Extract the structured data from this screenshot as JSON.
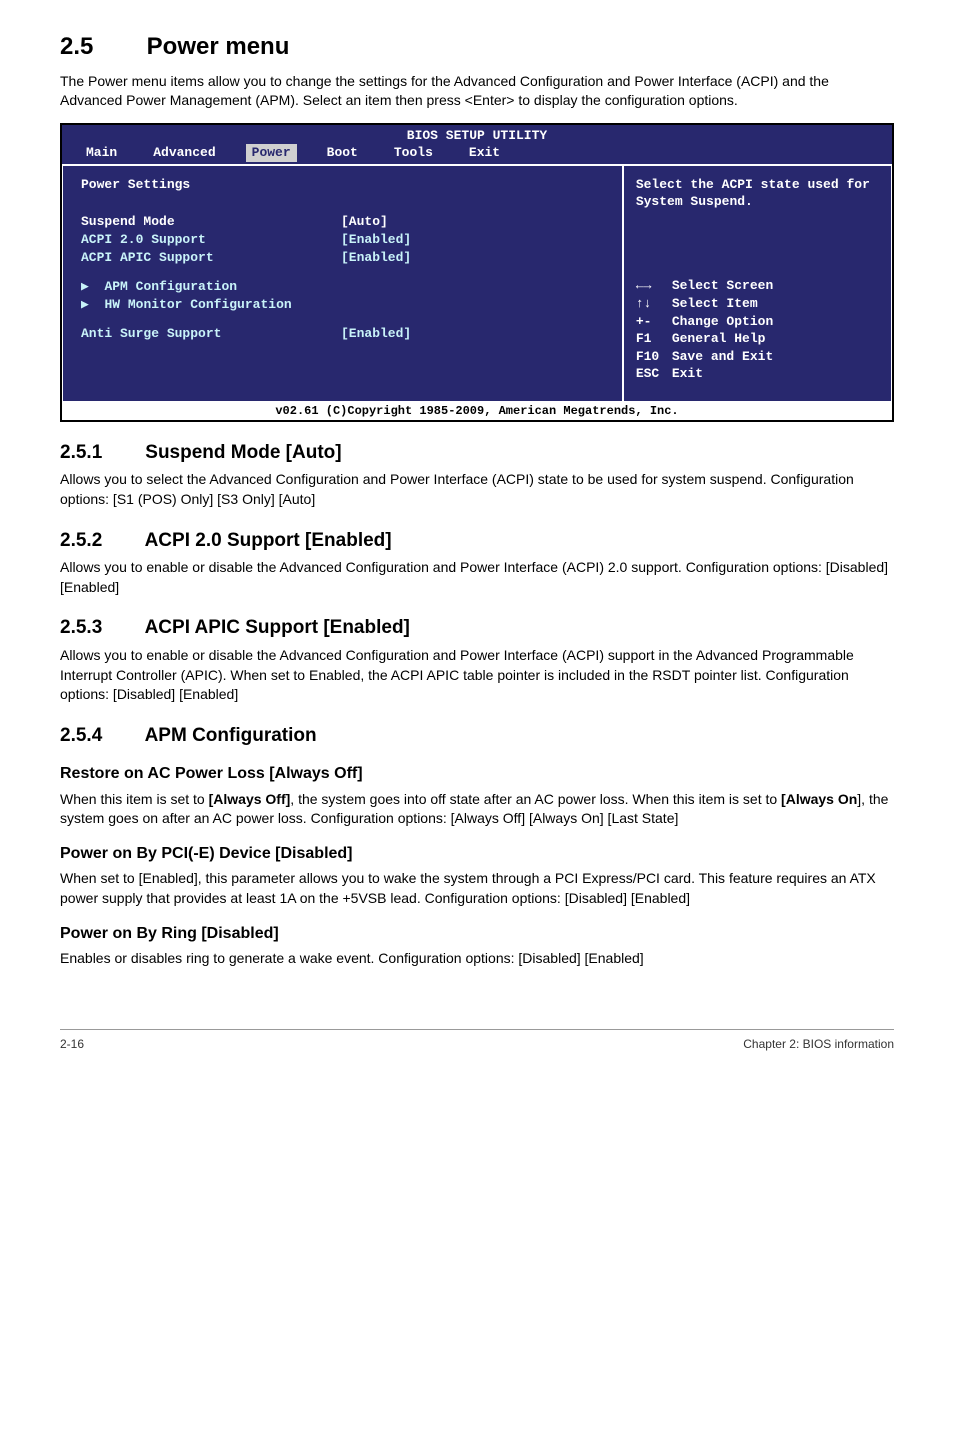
{
  "h1_num": "2.5",
  "h1_title": "Power menu",
  "intro": "The Power menu items allow you to change the settings for the Advanced Configuration and Power Interface (ACPI) and the Advanced Power Management (APM). Select an item then press <Enter> to display the configuration options.",
  "bios": {
    "title": "BIOS SETUP UTILITY",
    "menu": {
      "main": "Main",
      "advanced": "Advanced",
      "power": "Power",
      "boot": "Boot",
      "tools": "Tools",
      "exit": "Exit"
    },
    "heading": "Power Settings",
    "rows": [
      {
        "label": "Suspend Mode",
        "value": "[Auto]",
        "sel": true
      },
      {
        "label": "ACPI 2.0 Support",
        "value": "[Enabled]"
      },
      {
        "label": "ACPI APIC Support",
        "value": "[Enabled]"
      }
    ],
    "subs": [
      "APM Configuration",
      "HW Monitor Configuration"
    ],
    "anti": {
      "label": "Anti Surge Support",
      "value": "[Enabled]"
    },
    "help_top": "Select the ACPI state used for System Suspend.",
    "keys": [
      {
        "k": "←→",
        "d": "Select Screen"
      },
      {
        "k": "↑↓",
        "d": "Select Item"
      },
      {
        "k": "+-",
        "d": "Change Option"
      },
      {
        "k": "F1",
        "d": "General Help"
      },
      {
        "k": "F10",
        "d": "Save and Exit"
      },
      {
        "k": "ESC",
        "d": "Exit"
      }
    ],
    "footer": "v02.61 (C)Copyright 1985-2009, American Megatrends, Inc."
  },
  "s251_num": "2.5.1",
  "s251_title": "Suspend Mode [Auto]",
  "s251_body": "Allows you to select the Advanced Configuration and Power Interface (ACPI) state to be used for system suspend. Configuration options: [S1 (POS) Only] [S3 Only] [Auto]",
  "s252_num": "2.5.2",
  "s252_title": "ACPI 2.0 Support [Enabled]",
  "s252_body": "Allows you to enable or disable the Advanced Configuration and Power Interface (ACPI) 2.0 support. Configuration options: [Disabled] [Enabled]",
  "s253_num": "2.5.3",
  "s253_title": "ACPI APIC Support [Enabled]",
  "s253_body": "Allows you to enable or disable the Advanced Configuration and Power Interface (ACPI) support in the Advanced Programmable Interrupt Controller (APIC). When set to Enabled, the ACPI APIC table pointer is included in the RSDT pointer list. Configuration options: [Disabled] [Enabled]",
  "s254_num": "2.5.4",
  "s254_title": "APM Configuration",
  "r1_title": "Restore on AC Power Loss [Always Off]",
  "r1_body_a": "When this item is set to ",
  "r1_body_b": "[Always Off]",
  "r1_body_c": ", the system goes into off state after an AC power loss. When this item is set to ",
  "r1_body_d": "[Always On",
  "r1_body_e": "], the system goes on after an AC power loss. Configuration options: [Always Off] [Always On] [Last State]",
  "r2_title": "Power on By PCI(-E) Device [Disabled]",
  "r2_body": "When set to [Enabled], this parameter allows you to wake the system through a PCI Express/PCI card. This feature requires an ATX power supply that provides at least 1A on the +5VSB lead. Configuration options: [Disabled] [Enabled]",
  "r3_title": "Power on By Ring [Disabled]",
  "r3_body": "Enables or disables ring to generate a wake event. Configuration options: [Disabled] [Enabled]",
  "footer_left": "2-16",
  "footer_right": "Chapter 2: BIOS information"
}
